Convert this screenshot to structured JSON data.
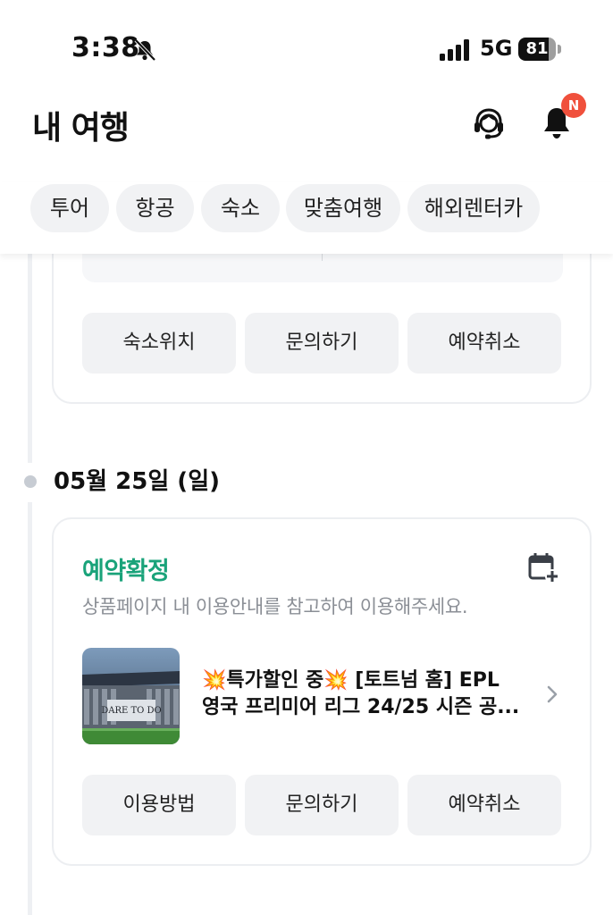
{
  "status_bar": {
    "time": "3:38",
    "network": "5G",
    "battery": "81",
    "battery_level": 0.81
  },
  "header": {
    "title": "내 여행",
    "notification_badge": "N",
    "badge_color": "#f0503c"
  },
  "tabs": [
    {
      "label": "투어"
    },
    {
      "label": "항공"
    },
    {
      "label": "숙소"
    },
    {
      "label": "맞춤여행"
    },
    {
      "label": "해외렌터카"
    }
  ],
  "previous_booking": {
    "buttons": [
      "숙소위치",
      "문의하기",
      "예약취소"
    ]
  },
  "date_group": {
    "date": "05월 25일 (일)"
  },
  "booking": {
    "status": "예약확정",
    "status_color": "#1aa37a",
    "notice": "상품페이지 내 이용안내를 참고하여 이용해주세요.",
    "product_line1": "💥특가할인 중💥 [토트넘 홈] EPL",
    "product_line2": "영국 프리미어 리그 24/25 시즌 공...",
    "thumbnail_text": "DARE TO DO",
    "buttons": [
      "이용방법",
      "문의하기",
      "예약취소"
    ]
  }
}
